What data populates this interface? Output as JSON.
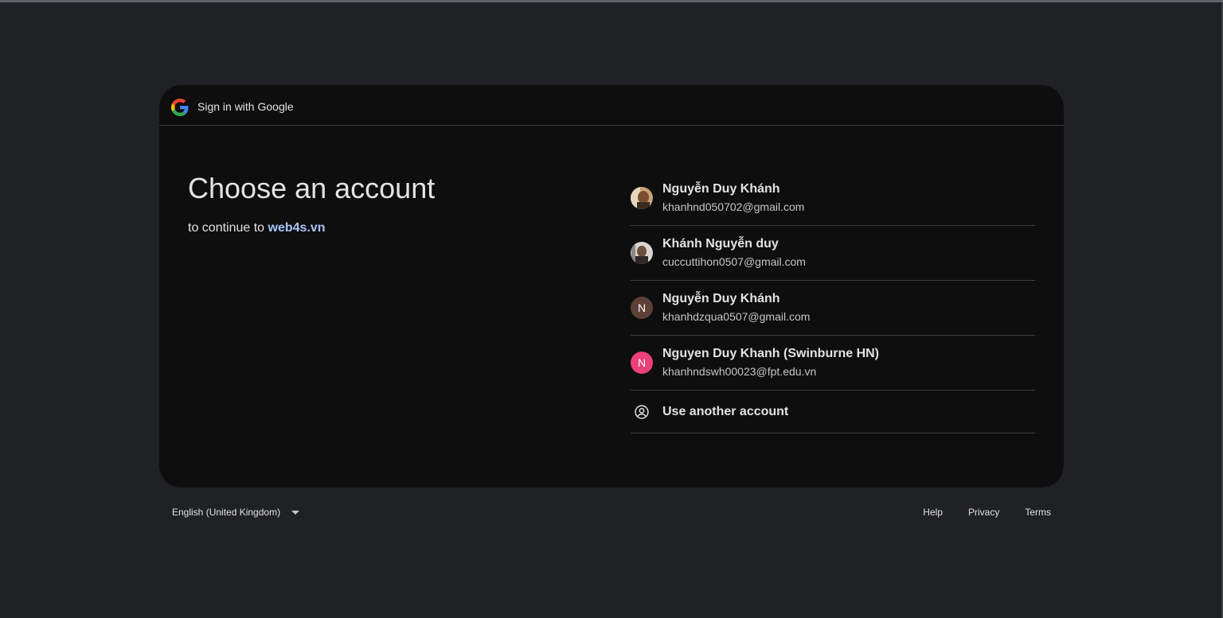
{
  "header": {
    "title": "Sign in with Google"
  },
  "main": {
    "heading": "Choose an account",
    "subtitle_prefix": "to continue to",
    "app_link": "web4s.vn"
  },
  "accounts": [
    {
      "name": "Nguyễn Duy Khánh",
      "email": "khanhnd050702@gmail.com",
      "avatar": "photo"
    },
    {
      "name": "Khánh Nguyễn duy",
      "email": "cuccuttihon0507@gmail.com",
      "avatar": "photo"
    },
    {
      "name": "Nguyễn Duy Khánh",
      "email": "khanhdzqua0507@gmail.com",
      "avatar_letter": "N",
      "avatar_color": "#5d4037"
    },
    {
      "name": "Nguyen Duy Khanh (Swinburne HN)",
      "email": "khanhndswh00023@fpt.edu.vn",
      "avatar_letter": "N",
      "avatar_color": "#ec407a"
    }
  ],
  "use_another": {
    "label": "Use another account",
    "icon": "account-circle-icon"
  },
  "footer": {
    "language": "English (United Kingdom)",
    "help": "Help",
    "privacy": "Privacy",
    "terms": "Terms"
  },
  "colors": {
    "background": "#202124",
    "card": "#0e0e0e",
    "link": "#a8c7fa"
  }
}
